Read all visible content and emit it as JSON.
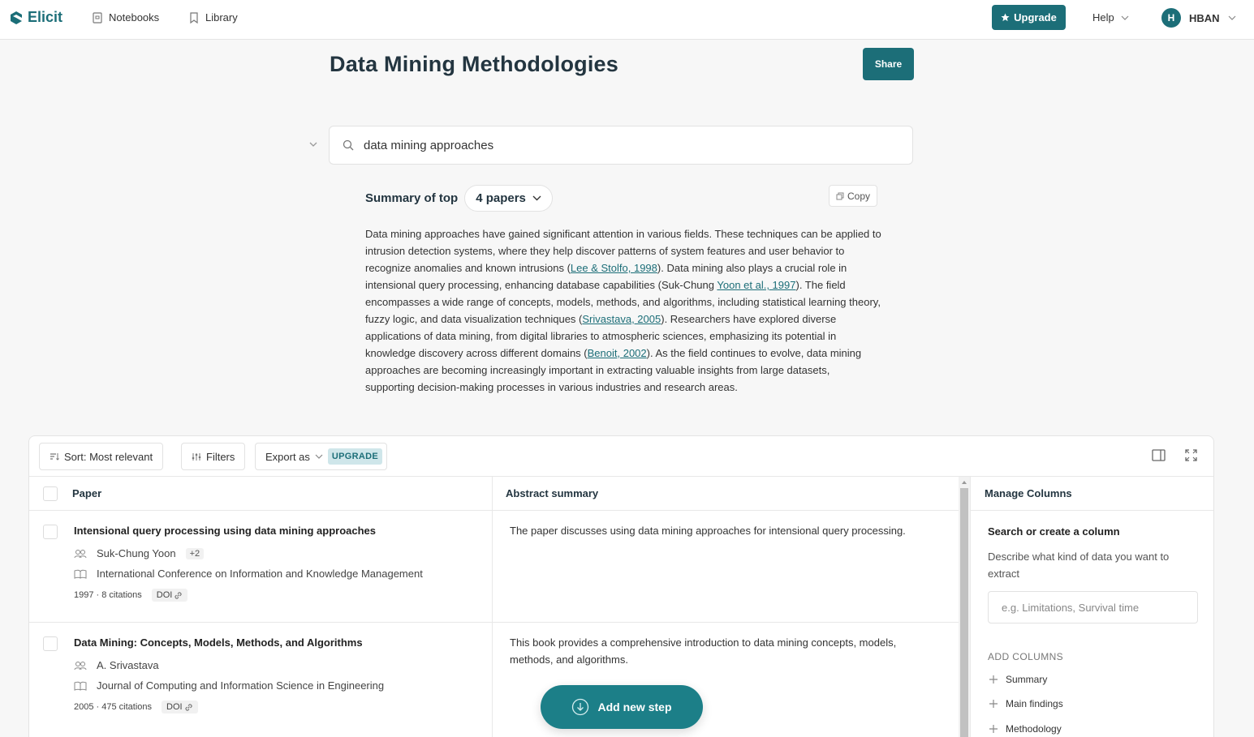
{
  "app": {
    "brand": "Elicit",
    "nav": [
      {
        "label": "Notebooks",
        "icon": "notebook-icon"
      },
      {
        "label": "Library",
        "icon": "bookmark-icon"
      }
    ],
    "upgrade_label": "Upgrade",
    "help_label": "Help",
    "user": {
      "initial": "H",
      "name": "HBAN"
    }
  },
  "page": {
    "title": "Data Mining Methodologies",
    "share_label": "Share"
  },
  "search": {
    "query": "data mining approaches"
  },
  "summary": {
    "label": "Summary of top",
    "papers_label": "4 papers",
    "copy_label": "Copy",
    "parts": [
      {
        "t": "Data mining approaches have gained significant attention in various fields. These techniques can be applied to intrusion detection systems, where they help discover patterns of system features and user behavior to recognize anomalies and known intrusions ("
      },
      {
        "t": "Lee & Stolfo, 1998",
        "link": true
      },
      {
        "t": "). Data mining also plays a crucial role in intensional query processing, enhancing database capabilities (Suk-Chung "
      },
      {
        "t": "Yoon et al., 1997",
        "link": true
      },
      {
        "t": "). The field encompasses a wide range of concepts, models, methods, and algorithms, including statistical learning theory, fuzzy logic, and data visualization techniques ("
      },
      {
        "t": "Srivastava, 2005",
        "link": true
      },
      {
        "t": "). Researchers have explored diverse applications of data mining, from digital libraries to atmospheric sciences, emphasizing its potential in knowledge discovery across different domains ("
      },
      {
        "t": "Benoit, 2002",
        "link": true
      },
      {
        "t": "). As the field continues to evolve, data mining approaches are becoming increasingly important in extracting valuable insights from large datasets, supporting decision-making processes in various industries and research areas."
      }
    ]
  },
  "toolbar": {
    "sort_label": "Sort: Most relevant",
    "filters_label": "Filters",
    "export_label": "Export as",
    "export_badge": "UPGRADE"
  },
  "table": {
    "headers": {
      "paper": "Paper",
      "abstract": "Abstract summary"
    },
    "rows": [
      {
        "title": "Intensional query processing using data mining approaches",
        "authors": "Suk-Chung Yoon",
        "authors_more": "+2",
        "venue": "International Conference on Information and Knowledge Management",
        "stats": "1997 · 8 citations",
        "doi": "DOI",
        "abstract": "The paper discusses using data mining approaches for intensional query processing."
      },
      {
        "title": "Data Mining: Concepts, Models, Methods, and Algorithms",
        "authors": "A. Srivastava",
        "authors_more": "",
        "venue": "Journal of Computing and Information Science in Engineering",
        "stats": "2005 · 475 citations",
        "doi": "DOI",
        "abstract": "This book provides a comprehensive introduction to data mining concepts, models, methods, and algorithms."
      }
    ]
  },
  "manage_columns": {
    "title": "Manage Columns",
    "search_label": "Search or create a column",
    "description": "Describe what kind of data you want to extract",
    "input_placeholder": "e.g. Limitations, Survival time",
    "add_heading": "ADD COLUMNS",
    "add_items": [
      "Summary",
      "Main findings",
      "Methodology"
    ]
  },
  "fab_label": "Add new step",
  "colors": {
    "accent": "#1c6e78",
    "fab": "#1c7f88",
    "badge_bg": "#cfe6ea"
  }
}
